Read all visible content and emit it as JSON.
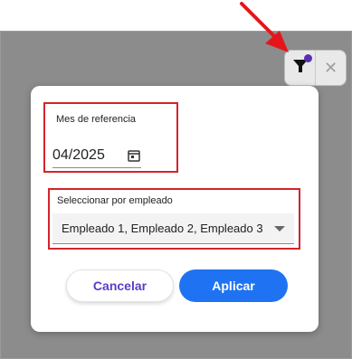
{
  "toolbar": {
    "filter_icon": "filter-icon",
    "close_icon": "close-icon",
    "close_glyph": "✕",
    "badge_color": "#5b2fb3"
  },
  "annotation": {
    "arrow_color": "#e5161b",
    "highlight_color": "#d3242b"
  },
  "dialog": {
    "month_label": "Mes de referencia",
    "month_value": "04/2025",
    "calendar_icon": "calendar-icon",
    "employee_label": "Seleccionar por empleado",
    "employee_value": "Empleado 1, Empleado 2, Empleado 3",
    "cancel_label": "Cancelar",
    "apply_label": "Aplicar",
    "accent_color": "#1f73f2"
  }
}
